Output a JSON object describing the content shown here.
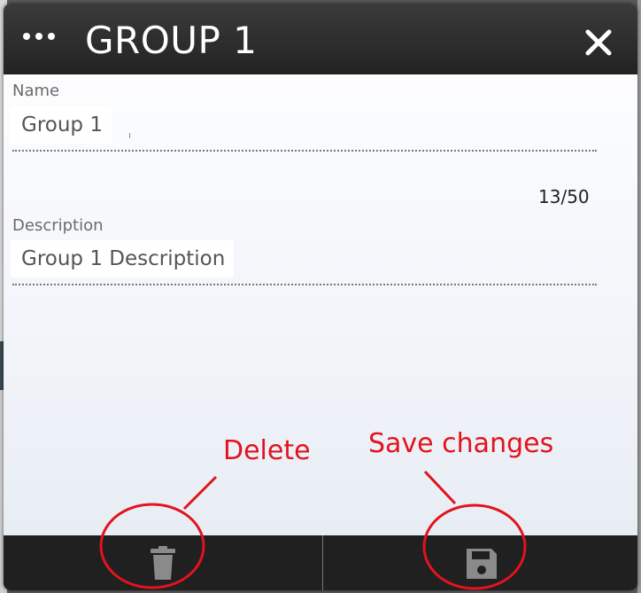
{
  "dialog": {
    "title": "GROUP 1",
    "menu_icon": "more-horizontal-icon",
    "close_icon": "close-icon"
  },
  "form": {
    "name": {
      "label": "Name",
      "value": "Group 1",
      "counter": "13/50"
    },
    "description": {
      "label": "Description",
      "value": "Group 1 Description"
    }
  },
  "footer": {
    "delete_icon": "trash-icon",
    "save_icon": "floppy-disk-icon"
  },
  "annotations": {
    "delete_label": "Delete",
    "save_label": "Save changes",
    "color": "#e3131d"
  },
  "colors": {
    "header_bg": "#2b2b2b",
    "footer_bg": "#202020",
    "icon_gray": "#8a8a8a"
  }
}
